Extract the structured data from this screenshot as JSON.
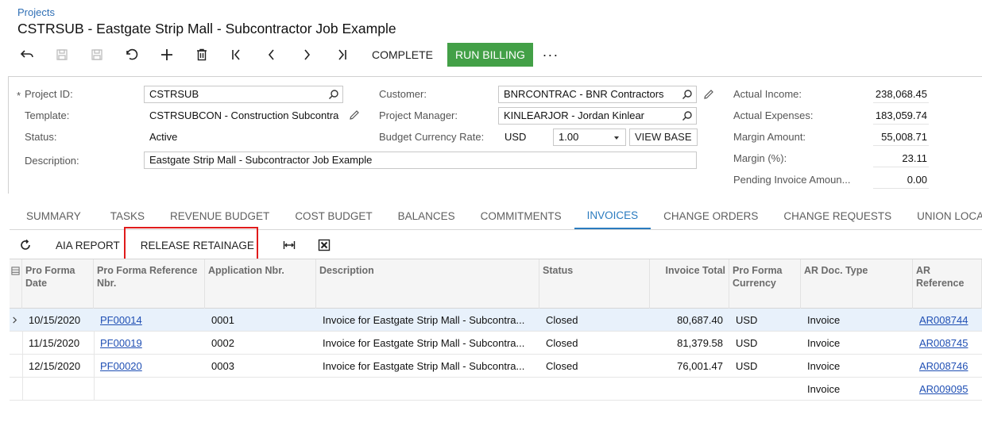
{
  "breadcrumb": "Projects",
  "title": "CSTRSUB - Eastgate Strip Mall - Subcontractor Job Example",
  "toolbar": {
    "icons": [
      "back-icon",
      "save-close-icon",
      "save-icon",
      "undo-icon",
      "add-icon",
      "delete-icon",
      "first-icon",
      "previous-icon",
      "next-icon",
      "last-icon"
    ],
    "complete_label": "COMPLETE",
    "run_billing_label": "RUN BILLING",
    "more_label": "···",
    "accent_color": "#43a047"
  },
  "form": {
    "required_mark": "*",
    "project_id": {
      "label": "Project ID:",
      "value": "CSTRSUB"
    },
    "template": {
      "label": "Template:",
      "value": "CSTRSUBCON - Construction Subcontra"
    },
    "status": {
      "label": "Status:",
      "value": "Active"
    },
    "description": {
      "label": "Description:",
      "value": "Eastgate Strip Mall - Subcontractor Job Example"
    },
    "customer": {
      "label": "Customer:",
      "value": "BNRCONTRAC - BNR Contractors"
    },
    "project_manager": {
      "label": "Project Manager:",
      "value": "KINLEARJOR - Jordan Kinlear"
    },
    "budget_currency_rate": {
      "label": "Budget Currency Rate:",
      "currency": "USD",
      "rate": "1.00",
      "button": "VIEW BASE"
    }
  },
  "summary": {
    "actual_income": {
      "label": "Actual Income:",
      "value": "238,068.45"
    },
    "actual_expenses": {
      "label": "Actual Expenses:",
      "value": "183,059.74"
    },
    "margin_amount": {
      "label": "Margin Amount:",
      "value": "55,008.71"
    },
    "margin_pct": {
      "label": "Margin (%):",
      "value": "23.11"
    },
    "pending_invoice": {
      "label": "Pending Invoice Amoun...",
      "value": "0.00"
    }
  },
  "tabs": [
    "SUMMARY",
    "TASKS",
    "REVENUE BUDGET",
    "COST BUDGET",
    "BALANCES",
    "COMMITMENTS",
    "INVOICES",
    "CHANGE ORDERS",
    "CHANGE REQUESTS",
    "UNION LOCALS"
  ],
  "active_tab": "INVOICES",
  "grid_toolbar": {
    "aia_report": "AIA REPORT",
    "release_retainage": "RELEASE RETAINAGE",
    "highlight_color": "#e01b1b"
  },
  "grid": {
    "columns": [
      "Pro Forma Date",
      "Pro Forma Reference Nbr.",
      "Application Nbr.",
      "Description",
      "Status",
      "Invoice Total",
      "Pro Forma Currency",
      "AR Doc. Type",
      "AR Reference"
    ],
    "rows": [
      {
        "date": "10/15/2020",
        "ref": "PF00014",
        "app": "0001",
        "desc": "Invoice for Eastgate Strip Mall - Subcontra...",
        "status": "Closed",
        "total": "80,687.40",
        "currency": "USD",
        "doc_type": "Invoice",
        "ar_ref": "AR008744"
      },
      {
        "date": "11/15/2020",
        "ref": "PF00019",
        "app": "0002",
        "desc": "Invoice for Eastgate Strip Mall - Subcontra...",
        "status": "Closed",
        "total": "81,379.58",
        "currency": "USD",
        "doc_type": "Invoice",
        "ar_ref": "AR008745"
      },
      {
        "date": "12/15/2020",
        "ref": "PF00020",
        "app": "0003",
        "desc": "Invoice for Eastgate Strip Mall - Subcontra...",
        "status": "Closed",
        "total": "76,001.47",
        "currency": "USD",
        "doc_type": "Invoice",
        "ar_ref": "AR008746"
      },
      {
        "date": "",
        "ref": "",
        "app": "",
        "desc": "",
        "status": "",
        "total": "",
        "currency": "",
        "doc_type": "Invoice",
        "ar_ref": "AR009095"
      }
    ]
  }
}
